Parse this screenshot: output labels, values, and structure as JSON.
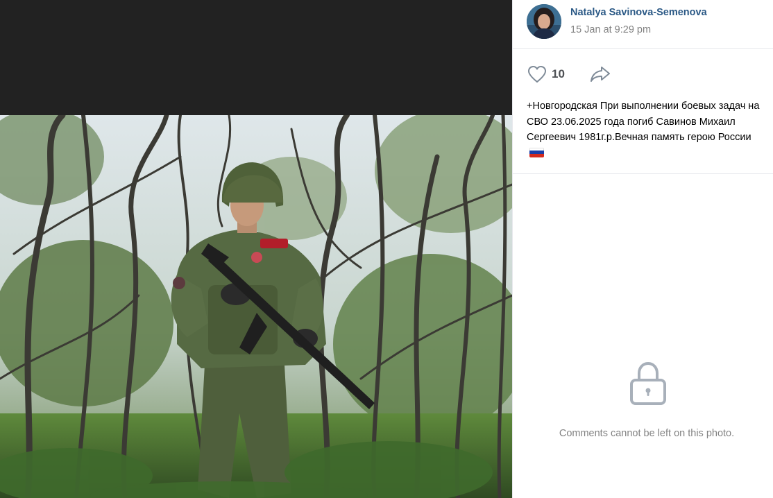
{
  "photo": {
    "description_icon": "photo-image"
  },
  "author": {
    "name": "Natalya Savinova-Semenova",
    "date": "15 Jan at 9:29 pm",
    "avatar_icon": "avatar-photo"
  },
  "actions": {
    "like_icon": "heart-icon",
    "like_count": "10",
    "share_icon": "share-arrow-icon"
  },
  "caption": {
    "text": "+Новгородская При выполнении боевых задач на СВО 23.06.2025 года погиб Савинов Михаил Сергеевич 1981г.р.Вечная память герою России",
    "flag_icon": "russia-flag-icon",
    "flag_colors": [
      "#ffffff",
      "#1c3fa8",
      "#d52b1e"
    ]
  },
  "comments": {
    "lock_icon": "lock-icon",
    "locked_message": "Comments cannot be left on this photo."
  },
  "colors": {
    "link": "#2a5885",
    "muted": "#828282",
    "viewer_bg": "#222222",
    "border": "#e7e8ec"
  }
}
